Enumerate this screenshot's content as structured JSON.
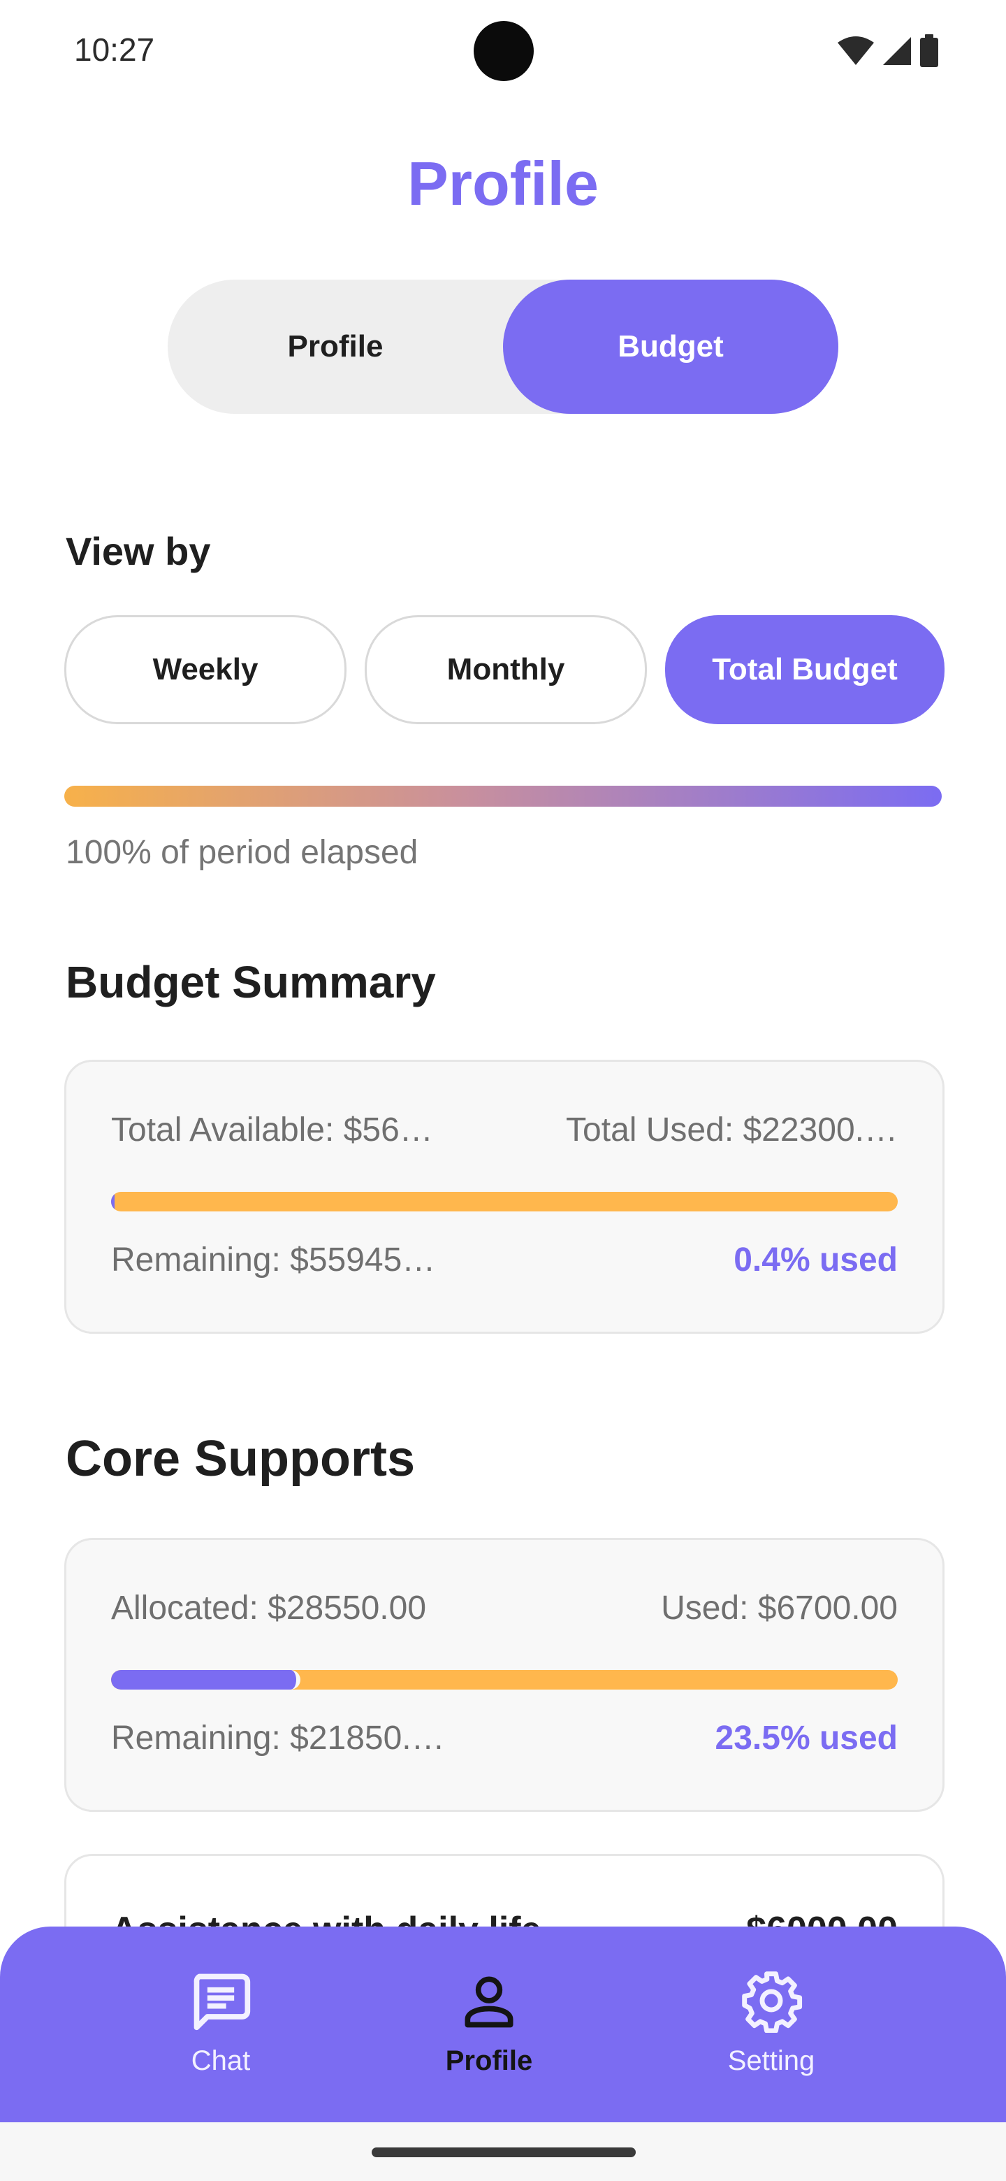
{
  "status_bar": {
    "time": "10:27",
    "icons": [
      "wifi-icon",
      "cellular-icon",
      "battery-icon"
    ]
  },
  "page": {
    "title": "Profile"
  },
  "segment": {
    "options": [
      "Profile",
      "Budget"
    ],
    "selected": "Budget"
  },
  "view_by": {
    "label": "View by",
    "options": [
      "Weekly",
      "Monthly",
      "Total Budget"
    ],
    "selected": "Total Budget"
  },
  "period": {
    "text": "100% of period elapsed",
    "fraction_elapsed": 1.0
  },
  "budget_summary": {
    "title": "Budget Summary",
    "total_available": "Total Available: $56…",
    "total_used": "Total Used: $22300.…",
    "remaining": "Remaining: $55945…",
    "percent_used": "0.4% used",
    "used_fraction": 0.004
  },
  "core_supports": {
    "title": "Core Supports",
    "allocated": "Allocated: $28550.00",
    "used": "Used: $6700.00",
    "remaining": "Remaining: $21850.…",
    "percent_used": "23.5% used",
    "used_fraction": 0.235
  },
  "daily_life": {
    "label": "Assistance with daily life",
    "amount": "$6000.00"
  },
  "bottom_nav": {
    "items": [
      {
        "label": "Chat",
        "icon": "chat-icon"
      },
      {
        "label": "Profile",
        "icon": "person-icon"
      },
      {
        "label": "Setting",
        "icon": "gear-icon"
      }
    ],
    "selected": "Profile"
  },
  "colors": {
    "accent": "#7b6cf2",
    "warning": "#ffb74d",
    "text": "#1f1f1f",
    "muted": "#757575"
  }
}
